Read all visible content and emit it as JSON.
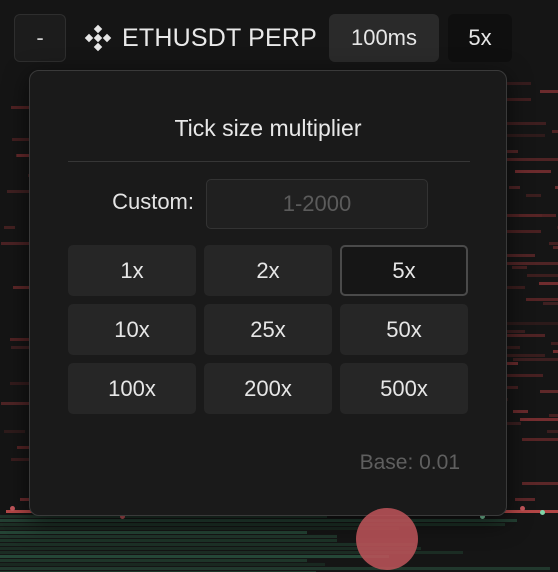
{
  "topbar": {
    "minus_label": "-",
    "ticker_icon": "binance-logo-icon",
    "ticker": "ETHUSDT PERP",
    "interval": "100ms",
    "multiplier": "5x"
  },
  "modal": {
    "title": "Tick size multiplier",
    "custom_label": "Custom:",
    "custom_placeholder": "1-2000",
    "custom_value": "",
    "options": [
      {
        "label": "1x",
        "selected": false
      },
      {
        "label": "2x",
        "selected": false
      },
      {
        "label": "5x",
        "selected": true
      },
      {
        "label": "10x",
        "selected": false
      },
      {
        "label": "25x",
        "selected": false
      },
      {
        "label": "50x",
        "selected": false
      },
      {
        "label": "100x",
        "selected": false
      },
      {
        "label": "200x",
        "selected": false
      },
      {
        "label": "500x",
        "selected": false
      }
    ],
    "base": "Base: 0.01"
  },
  "colors": {
    "ask": "#7a2f31",
    "bid": "#274a39",
    "trade_sell": "#c0555a",
    "trade_buy": "#7fd4a8"
  }
}
